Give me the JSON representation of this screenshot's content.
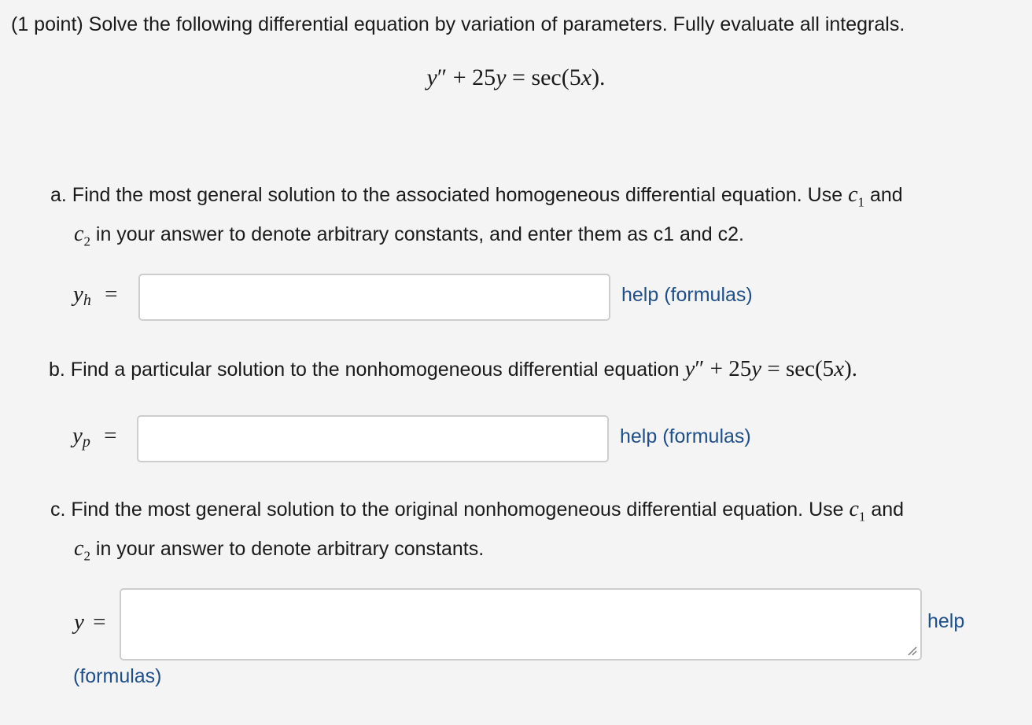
{
  "problem": {
    "intro": "(1 point) Solve the following differential equation by variation of parameters. Fully evaluate all integrals.",
    "equation": {
      "lhs_var": "y",
      "prime": "″",
      "plus": "+ 25",
      "lhs_var2": "y",
      "equals": "=",
      "rhs": "sec(5",
      "rhs_var": "x",
      "rhs_close": ")."
    }
  },
  "part_a": {
    "line1": "a. Find the most general solution to the associated homogeneous differential equation. Use",
    "c1": "c",
    "c1_sub": "1",
    "and": "and",
    "c2": "c",
    "c2_sub": "2",
    "line2": "in your answer to denote arbitrary constants, and enter them as c1 and c2.",
    "label_var": "y",
    "label_sub": "h",
    "label_eq": "=",
    "input_value": "",
    "help": "help (formulas)"
  },
  "part_b": {
    "text": "b. Find a particular solution to the nonhomogeneous differential equation",
    "eq_var": "y",
    "eq_prime": "″",
    "eq_plus": "+ 25",
    "eq_var2": "y",
    "eq_equals": "=",
    "eq_rhs": "sec(5",
    "eq_rhs_var": "x",
    "eq_close": ").",
    "label_var": "y",
    "label_sub": "p",
    "label_eq": "=",
    "input_value": "",
    "help": "help (formulas)"
  },
  "part_c": {
    "line1": "c. Find the most general solution to the original nonhomogeneous differential equation. Use",
    "c1": "c",
    "c1_sub": "1",
    "and": "and",
    "c2": "c",
    "c2_sub": "2",
    "line2": "in your answer to denote arbitrary constants.",
    "label_var": "y",
    "label_eq": "=",
    "input_value": "",
    "help": "help",
    "formulas": "(formulas)"
  },
  "colors": {
    "background": "#f4f4f4",
    "link": "#1f4f8b",
    "input_border": "#cdcdcd"
  }
}
